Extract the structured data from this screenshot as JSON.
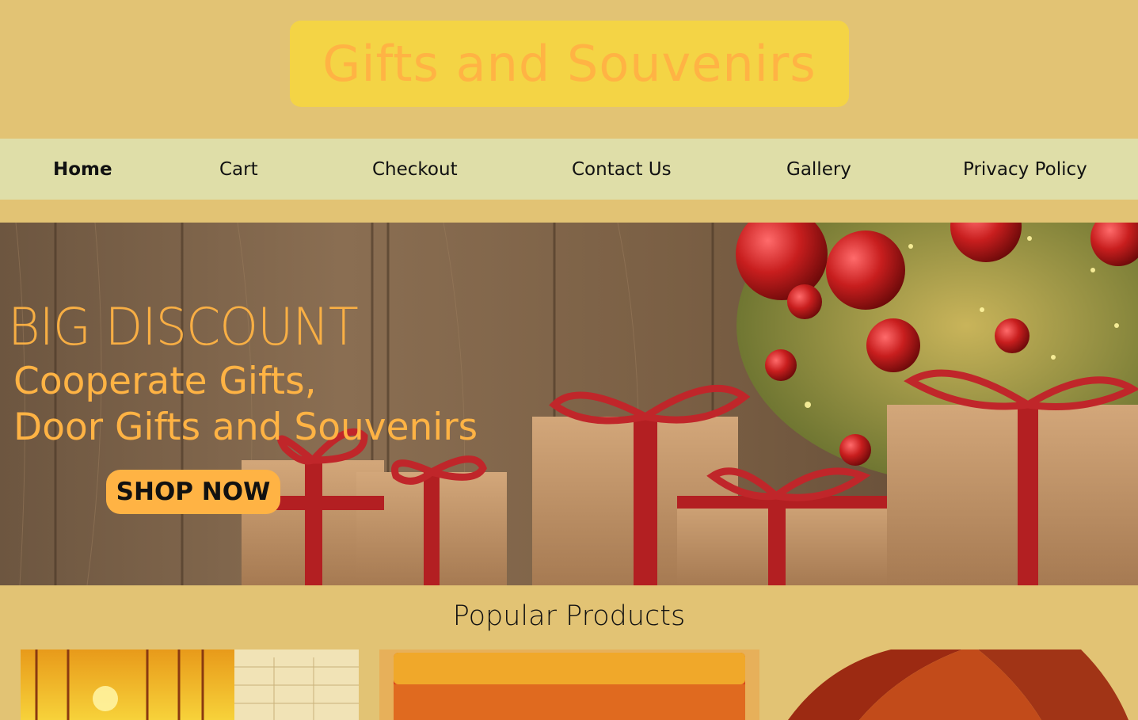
{
  "site": {
    "logo_text": "Gifts and Souvenirs"
  },
  "nav": {
    "items": [
      {
        "label": "Home",
        "active": true
      },
      {
        "label": "Cart",
        "active": false
      },
      {
        "label": "Checkout",
        "active": false
      },
      {
        "label": "Contact Us",
        "active": false
      },
      {
        "label": "Gallery",
        "active": false
      },
      {
        "label": "Privacy Policy",
        "active": false
      }
    ]
  },
  "hero": {
    "heading": "BIG DISCOUNT",
    "subheading_line1": "Cooperate Gifts,",
    "subheading_line2": "Door Gifts and Souvenirs",
    "cta_label": "SHOP NOW"
  },
  "products": {
    "title": "Popular Products",
    "items": [
      {
        "image": "calendar-photo"
      },
      {
        "image": "gift-box-photo"
      },
      {
        "image": "bag-photo"
      }
    ]
  },
  "colors": {
    "page_background": "#e2c374",
    "logo_background": "#f4d445",
    "accent_orange": "#ffb344",
    "nav_background": "#dfdea8"
  }
}
